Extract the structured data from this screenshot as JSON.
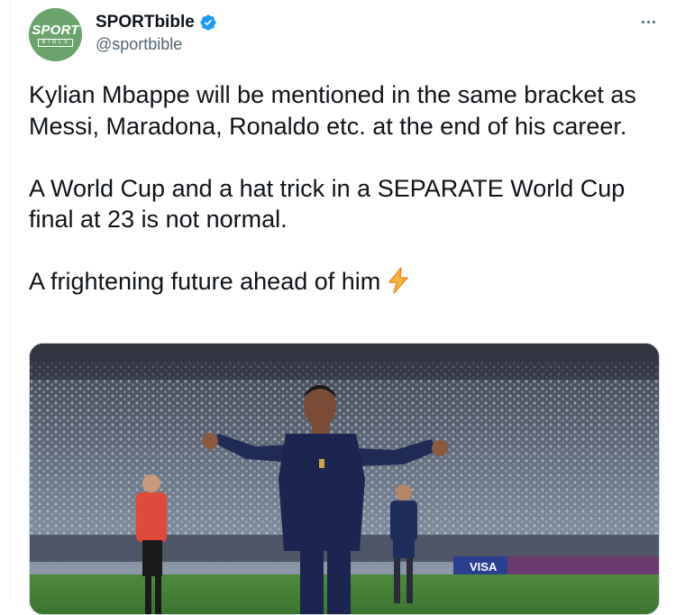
{
  "tweet": {
    "author": {
      "display_name": "SPORTbible",
      "handle": "@sportbible",
      "verified": true,
      "avatar_logo_top": "SPORT",
      "avatar_logo_bottom": "BIBLE",
      "avatar_color": "#6ca36c",
      "verified_color": "#1d9bf0"
    },
    "more_icon": "more-horizontal-icon",
    "paragraphs": [
      "Kylian Mbappe will be mentioned in the same bracket as Messi, Maradona, Ronaldo etc. at the end of his career.",
      "A World Cup and a hat trick in a SEPARATE World Cup final at 23 is not normal.",
      "A frightening future ahead of him"
    ],
    "emoji": "lightning-bolt-icon",
    "media": {
      "type": "photo",
      "description": "Player in dark blue kit celebrating with arms outstretched in a packed stadium",
      "sponsor_text": "VISA"
    }
  }
}
